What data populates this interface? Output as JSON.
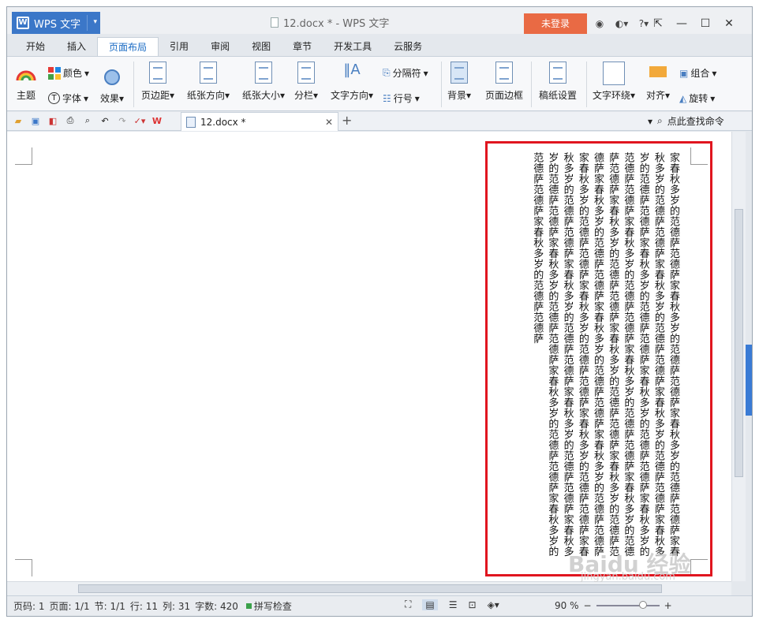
{
  "app": {
    "name": "WPS 文字",
    "window_title": "12.docx * - WPS 文字",
    "login_label": "未登录"
  },
  "tabs": [
    "开始",
    "插入",
    "页面布局",
    "引用",
    "审阅",
    "视图",
    "章节",
    "开发工具",
    "云服务"
  ],
  "active_tab": "页面布局",
  "ribbon": {
    "color": "颜色",
    "theme": "主题",
    "font": "字体",
    "effect": "效果",
    "margins": "页边距",
    "orientation": "纸张方向",
    "size": "纸张大小",
    "columns": "分栏",
    "text_direction": "文字方向",
    "breaks": "分隔符",
    "line_numbers": "行号",
    "background": "背景",
    "page_border": "页面边框",
    "manuscript": "稿纸设置",
    "wrap_text": "文字环绕",
    "align": "对齐",
    "group": "组合",
    "rotate": "旋转"
  },
  "doc_tab": {
    "name": "12.docx *"
  },
  "find_command": "点此查找命令",
  "document": {
    "text": "家春秋多岁的范德萨范德萨家春秋多岁的范德萨范德萨家春秋多岁的范德萨范德萨家春秋多岁的范德萨范德萨家春秋多岁的范德萨范德萨家春秋多岁的范德萨范德萨家春秋多岁的范德萨范德萨家春秋多岁的范德萨范德萨家春秋多岁的范德萨范德萨家春秋多岁的范德萨范德萨家春秋多岁的范德萨范德萨家春秋多岁的范德萨范德萨家春秋多岁的范德萨范德萨家春秋多岁的范德萨范德萨家春秋多岁的范德萨范德萨家春秋多岁的范德萨范德萨家春秋多岁的范德萨范德萨家春秋多岁的范德萨范德萨家春秋多岁的范德萨范德萨家春秋多岁的范德萨范德萨家春秋多岁的范德萨范德萨家春秋多岁的范德萨范德萨家春秋多岁的范德萨范德萨家春秋多岁的范德萨范德萨家春秋多岁的范德萨范德萨家春秋多岁的范德萨范德萨家春秋多岁的范德萨范德萨家春秋多岁的范德萨范德萨家春秋多岁的范德萨范德萨家春秋多岁的范德萨范德萨"
  },
  "status": {
    "page_num": "页码: 1",
    "pages": "页面: 1/1",
    "section": "节: 1/1",
    "row": "行: 11",
    "col": "列: 31",
    "word_count": "字数: 420",
    "spell_check": "拼写检查",
    "zoom": "90 %"
  },
  "watermark": {
    "brand": "Baidu 经验",
    "url": "jingyan.baidu.com"
  },
  "colors": {
    "accent": "#3b77c8",
    "login": "#e96a44",
    "highlight_border": "#e0151f",
    "spell_ok": "#3aa14a"
  }
}
